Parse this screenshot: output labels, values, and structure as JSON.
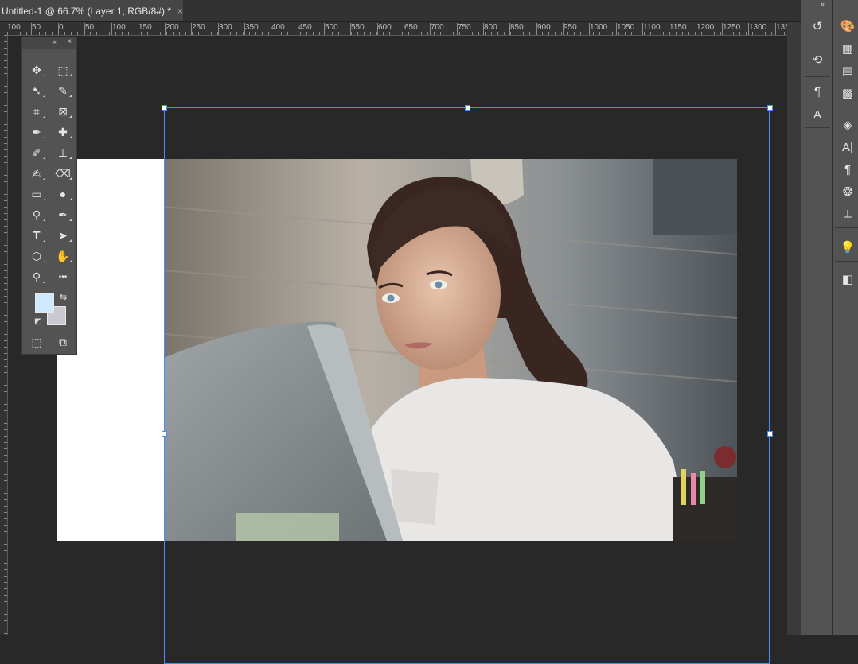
{
  "document": {
    "tab_title": "Untitled-1 @ 66.7% (Layer 1, RGB/8#) *",
    "close_glyph": "×"
  },
  "ruler": {
    "labels": [
      "100",
      "50",
      "0",
      "50",
      "100",
      "150",
      "200",
      "250",
      "300",
      "350",
      "400",
      "450",
      "500",
      "550",
      "600",
      "650",
      "700",
      "750",
      "800",
      "850",
      "900",
      "950",
      "1000",
      "1050",
      "1100",
      "1150",
      "1200",
      "1250",
      "1300",
      "135"
    ]
  },
  "tools": {
    "items": [
      {
        "name": "move-tool-icon",
        "glyph": "✥"
      },
      {
        "name": "marquee-tool-icon",
        "glyph": "⬚"
      },
      {
        "name": "lasso-tool-icon",
        "glyph": "➷"
      },
      {
        "name": "quick-selection-tool-icon",
        "glyph": "✎"
      },
      {
        "name": "crop-tool-icon",
        "glyph": "⌗"
      },
      {
        "name": "frame-tool-icon",
        "glyph": "⊠"
      },
      {
        "name": "eyedropper-tool-icon",
        "glyph": "✒"
      },
      {
        "name": "healing-brush-tool-icon",
        "glyph": "✚"
      },
      {
        "name": "brush-tool-icon",
        "glyph": "✐"
      },
      {
        "name": "clone-stamp-tool-icon",
        "glyph": "⊥"
      },
      {
        "name": "history-brush-tool-icon",
        "glyph": "✍"
      },
      {
        "name": "eraser-tool-icon",
        "glyph": "⌫"
      },
      {
        "name": "gradient-tool-icon",
        "glyph": "▭"
      },
      {
        "name": "blur-tool-icon",
        "glyph": "●"
      },
      {
        "name": "dodge-tool-icon",
        "glyph": "⚲"
      },
      {
        "name": "pen-tool-icon",
        "glyph": "✒"
      },
      {
        "name": "type-tool-icon",
        "glyph": "T"
      },
      {
        "name": "path-selection-tool-icon",
        "glyph": "➤"
      },
      {
        "name": "shape-tool-icon",
        "glyph": "⬡"
      },
      {
        "name": "hand-tool-icon",
        "glyph": "✋"
      },
      {
        "name": "zoom-tool-icon",
        "glyph": "⚲"
      },
      {
        "name": "more-tools-icon",
        "glyph": "•••"
      }
    ],
    "foreground_color": "#cfe8fb",
    "background_color": "#c9c9cf"
  },
  "panels": {
    "strip1": [
      "history-icon",
      "brush-settings-icon",
      "clone-source-icon",
      "character-styles-icon"
    ],
    "strip2": [
      "color-icon",
      "swatches-icon",
      "gradients-icon",
      "patterns-icon",
      "layers-icon",
      "character-icon",
      "paragraph-icon",
      "channels-icon",
      "paths-icon",
      "learn-icon",
      "libraries-icon"
    ]
  },
  "colors": {
    "accent": "#4a8cff",
    "panel": "#535353",
    "workspace": "#282828"
  }
}
